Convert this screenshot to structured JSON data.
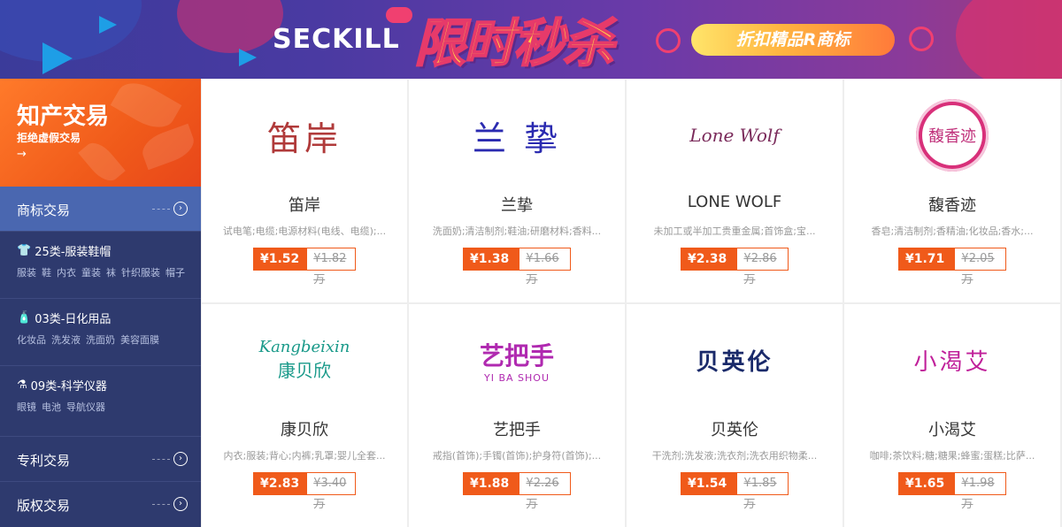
{
  "banner": {
    "seckill": "SECKILL",
    "title": "限时秒杀",
    "promo": "折扣精品R商标",
    "colors": {
      "accent_pink": "#f04070",
      "blue_triangle": "#1e9ee6",
      "title_yellow": "#ffd24a"
    }
  },
  "sidebar": {
    "hero": {
      "title": "知产交易",
      "subtitle": "拒绝虚假交易",
      "arrow": "→"
    },
    "active_item": {
      "label": "商标交易"
    },
    "categories": [
      {
        "icon": "shirt-icon",
        "glyph": "👕",
        "title": "25类-服装鞋帽",
        "tags": [
          "服装",
          "鞋",
          "内衣",
          "童装",
          "袜",
          "针织服装",
          "帽子"
        ]
      },
      {
        "icon": "bottle-icon",
        "glyph": "🧴",
        "title": "03类-日化用品",
        "tags": [
          "化妆品",
          "洗发液",
          "洗面奶",
          "美容面膜"
        ]
      },
      {
        "icon": "flask-icon",
        "glyph": "⚗",
        "title": "09类-科学仪器",
        "tags": [
          "眼镜",
          "电池",
          "导航仪器"
        ]
      }
    ],
    "bottom_items": [
      {
        "label": "专利交易"
      },
      {
        "label": "版权交易"
      }
    ],
    "colors": {
      "bg": "#2e3a6e",
      "active": "#4a67b0",
      "hero": "#f05a1a"
    }
  },
  "cards": [
    {
      "logo_text": "笛岸",
      "name": "笛岸",
      "desc": "试电笔;电缆;电源材料(电线、电缆);...",
      "price": "¥1.52万",
      "old_price": "¥1.82万",
      "logo_color": "#b03a3a"
    },
    {
      "logo_text": "兰 挚",
      "name": "兰挚",
      "desc": "洗面奶;清洁制剂;鞋油;研磨材料;香料...",
      "price": "¥1.38万",
      "old_price": "¥1.66万",
      "logo_color": "#2a2ab0"
    },
    {
      "logo_text": "Lone Wolf",
      "name": "LONE WOLF",
      "desc": "未加工或半加工贵重金属;首饰盒;宝...",
      "price": "¥2.38万",
      "old_price": "¥2.86万",
      "logo_color": "#7a2a5a"
    },
    {
      "logo_text": "馥香迹",
      "name": "馥香迹",
      "desc": "香皂;清洁制剂;香精油;化妆品;香水;...",
      "price": "¥1.71万",
      "old_price": "¥2.05万",
      "logo_color": "#c0307a"
    },
    {
      "logo_text": "Kangbeixin",
      "logo_text2": "康贝欣",
      "name": "康贝欣",
      "desc": "内衣;服装;背心;内裤;乳罩;婴儿全套...",
      "price": "¥2.83万",
      "old_price": "¥3.40万",
      "logo_color": "#1a9a8a"
    },
    {
      "logo_text": "艺把手",
      "logo_text2": "YI BA SHOU",
      "name": "艺把手",
      "desc": "戒指(首饰);手镯(首饰);护身符(首饰);...",
      "price": "¥1.88万",
      "old_price": "¥2.26万",
      "logo_color": "#b02ab0"
    },
    {
      "logo_text": "贝英伦",
      "name": "贝英伦",
      "desc": "干洗剂;洗发液;洗衣剂;洗衣用织物柔...",
      "price": "¥1.54万",
      "old_price": "¥1.85万",
      "logo_color": "#1a2a6a"
    },
    {
      "logo_text": "小渴艾",
      "name": "小渴艾",
      "desc": "咖啡;茶饮料;糖;糖果;蜂蜜;蛋糕;比萨...",
      "price": "¥1.65万",
      "old_price": "¥1.98万",
      "logo_color": "#c0209a"
    }
  ]
}
